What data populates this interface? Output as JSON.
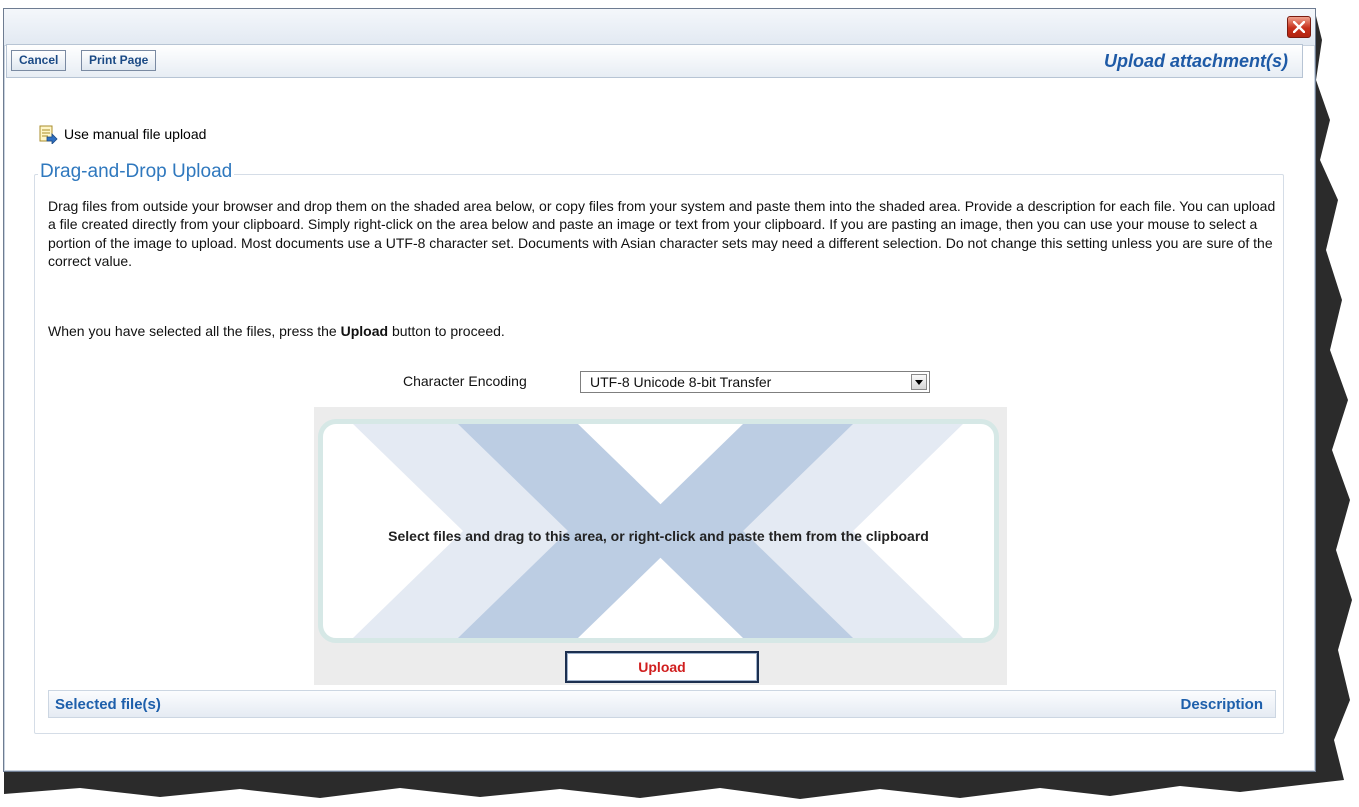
{
  "dialog": {
    "title": "Upload attachment(s)",
    "close_icon": "close-icon"
  },
  "toolbar": {
    "cancel_label": "Cancel",
    "print_label": "Print Page"
  },
  "manual_upload": {
    "label": "Use manual file upload",
    "icon": "manual-upload-icon"
  },
  "drag_drop": {
    "legend": "Drag-and-Drop Upload",
    "intro": "Drag files from outside your browser and drop them on the shaded area below, or copy files from your system and paste them into the shaded area. Provide a description for each file. You can upload a file created directly from your clipboard. Simply right-click on the area below and paste an image or text from your clipboard. If you are pasting an image, then you can use your mouse to select a portion of the image to upload. Most documents use a UTF-8 character set. Documents with Asian character sets may need a different selection. Do not change this setting unless you are sure of the correct value.",
    "instruction_before": "When you have selected all the files, press the ",
    "instruction_bold": "Upload",
    "instruction_after": " button to proceed.",
    "encoding_label": "Character Encoding",
    "encoding_value": "UTF-8 Unicode 8-bit Transfer",
    "drop_text": "Select files and drag to this area, or right-click and paste them from the clipboard",
    "upload_label": "Upload"
  },
  "table": {
    "col_files": "Selected file(s)",
    "col_description": "Description"
  },
  "colors": {
    "accent": "#1e5aa6",
    "legend": "#2f78be",
    "upload_text": "#d01e1e",
    "chevron_light": "#e4eaf3",
    "chevron_dark": "#bccde3"
  }
}
